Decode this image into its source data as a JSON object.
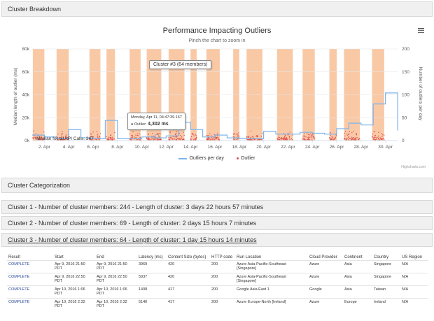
{
  "panels": {
    "breakdown": "Cluster Breakdown",
    "categorization": "Cluster Categorization",
    "cluster1": "Cluster 1 - Number of cluster members: 244 - Length of cluster: 3 days 22 hours 57 minutes",
    "cluster2": "Cluster 2 - Number of cluster members: 69 - Length of cluster: 2 days 15 hours 7 minutes",
    "cluster3": "Cluster 3 - Number of cluster members: 64 - Length of cluster: 1 day 15 hours 14 minutes"
  },
  "chart": {
    "title": "Performance Impacting Outliers",
    "subtitle": "Pinch the chart to zoom in",
    "credits": "Highcharts.com",
    "median_label": "Median for all API Calls: 347",
    "tooltip_cluster": "Cluster #3 (64 members)",
    "tooltip_outlier_time": "Monday, Apr 11, 04:47:39.167",
    "tooltip_outlier_prefix": "● Outlier: ",
    "tooltip_outlier_value": "4,302 ms",
    "legend_line": "Outliers per day",
    "legend_dots": "Outlier"
  },
  "chart_data": {
    "type": "line",
    "title": "Performance Impacting Outliers",
    "ylabel": "Median length of outlier (ms)",
    "y2label": "Number of outliers per day",
    "ylim": [
      0,
      80000
    ],
    "y2lim": [
      0,
      200
    ],
    "yticks": [
      "0k",
      "20k",
      "40k",
      "60k",
      "80k"
    ],
    "y2ticks": [
      "0",
      "50",
      "100",
      "150",
      "200"
    ],
    "xticks": [
      "2. Apr",
      "4. Apr",
      "6. Apr",
      "8. Apr",
      "10. Apr",
      "12. Apr",
      "14. Apr",
      "16. Apr",
      "18. Apr",
      "20. Apr",
      "22. Apr",
      "24. Apr",
      "26. Apr",
      "28. Apr",
      "30. Apr"
    ],
    "xlim": [
      1,
      31
    ],
    "clusters": [
      [
        1.05,
        2.0
      ],
      [
        3.0,
        4.0
      ],
      [
        5.7,
        6.6
      ],
      [
        7.1,
        7.8
      ],
      [
        9.0,
        9.9
      ],
      [
        10.4,
        11.6
      ],
      [
        12.2,
        13.5
      ],
      [
        14.0,
        14.5
      ],
      [
        15.3,
        16.4
      ],
      [
        17.5,
        18.0
      ],
      [
        18.6,
        19.9
      ],
      [
        21.1,
        22.4
      ],
      [
        23.2,
        24.2
      ],
      [
        25.4,
        26.0
      ],
      [
        26.6,
        27.9
      ],
      [
        28.9,
        29.9
      ]
    ],
    "series": [
      {
        "name": "Outliers per day",
        "x": [
          1,
          2,
          3,
          4,
          5,
          6,
          7,
          8,
          9,
          10,
          11,
          12,
          13,
          14,
          15,
          16,
          17,
          18,
          19,
          20,
          21,
          22,
          23,
          24,
          25,
          26,
          27,
          28,
          29,
          30,
          31
        ],
        "values": [
          12,
          8,
          4,
          24,
          6,
          4,
          44,
          4,
          4,
          8,
          6,
          10,
          40,
          24,
          8,
          12,
          6,
          4,
          4,
          20,
          14,
          14,
          18,
          16,
          14,
          26,
          38,
          34,
          80,
          104,
          22
        ]
      }
    ]
  },
  "table": {
    "headers": [
      "Result",
      "Start",
      "End",
      "Latency (ms)",
      "Content Size (bytes)",
      "HTTP code",
      "Run Location",
      "Cloud Provider",
      "Continent",
      "Country",
      "US Region"
    ],
    "rows": [
      [
        "COMPLETE",
        "Apr 9, 2016 21:50 PDT",
        "Apr 9, 2016 21:50 PDT",
        "3969",
        "420",
        "200",
        "Azure Asia-Pacific-Southeast [Singapore]",
        "Azure",
        "Asia",
        "Singapore",
        "N/A"
      ],
      [
        "COMPLETE",
        "Apr 9, 2016 22:50 PDT",
        "Apr 9, 2016 22:50 PDT",
        "5937",
        "420",
        "200",
        "Azure Asia-Pacific-Southeast [Singapore]",
        "Azure",
        "Asia",
        "Singapore",
        "N/A"
      ],
      [
        "COMPLETE",
        "Apr 10, 2016 1:06 PDT",
        "Apr 10, 2016 1:06 PDT",
        "1408",
        "417",
        "200",
        "Google Asia East 1",
        "Google",
        "Asia",
        "Taiwan",
        "N/A"
      ],
      [
        "COMPLETE",
        "Apr 10, 2016 2:32 PDT",
        "Apr 10, 2016 2:32 PDT",
        "5140",
        "417",
        "200",
        "Azure Europe-North [Ireland]",
        "Azure",
        "Europe",
        "Ireland",
        "N/A"
      ]
    ]
  },
  "colors": {
    "cluster_band": "#f9c9a6",
    "line": "#7cb5ec",
    "outlier_dot": "#e05050"
  }
}
